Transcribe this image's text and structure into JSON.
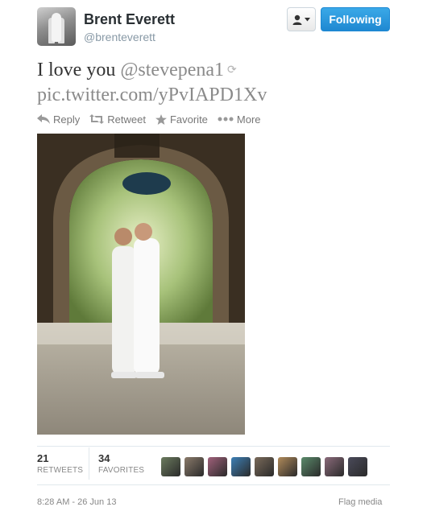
{
  "user": {
    "fullname": "Brent Everett",
    "username": "@brenteverett"
  },
  "buttons": {
    "follow_label": "Following",
    "user_actions_icon": "user-dropdown-icon"
  },
  "tweet": {
    "text_prefix": "I love you ",
    "mention": "@stevepena1",
    "pic_link": "pic.twitter.com/yPvIAPD1Xv"
  },
  "actions": [
    {
      "label": "Reply",
      "icon": "reply-icon"
    },
    {
      "label": "Retweet",
      "icon": "retweet-icon"
    },
    {
      "label": "Favorite",
      "icon": "star-icon"
    },
    {
      "label": "More",
      "icon": "more-dots-icon"
    }
  ],
  "stats": {
    "retweets_count": "21",
    "retweets_label": "RETWEETS",
    "favorites_count": "34",
    "favorites_label": "FAVORITES"
  },
  "favoriter_avatar_colors": [
    "#6b7b5e",
    "#8a7a6a",
    "#a0607a",
    "#3d7fb5",
    "#7a6a5a",
    "#b08a5a",
    "#5a8a6a",
    "#8a6a7a",
    "#4a4a5a"
  ],
  "footer": {
    "timestamp": "8:28 AM - 26 Jun 13",
    "flag_link": "Flag media"
  },
  "colors": {
    "follow_button": "#2b9be0",
    "link_gray": "#8a8a8a"
  }
}
